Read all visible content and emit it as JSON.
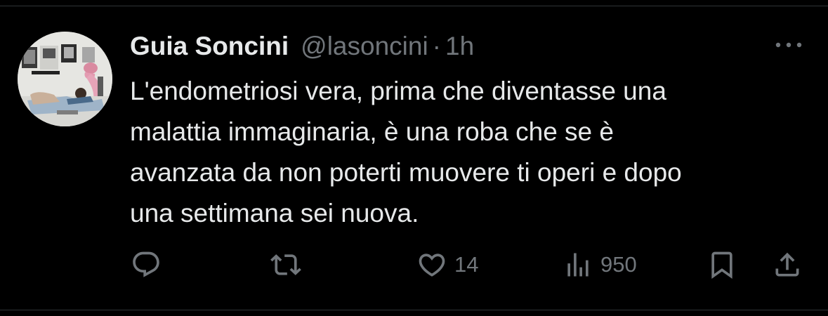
{
  "tweet": {
    "author": {
      "display_name": "Guia Soncini",
      "handle": "@lasoncini",
      "separator": "·",
      "time": "1h",
      "avatar_icon": "profile-photo"
    },
    "text": "L'endometriosi vera, prima che diventasse una\nmalattia immaginaria, è una roba che se è\navanzata da non poterti muovere ti operi e dopo\nuna settimana sei nuova.",
    "more_icon": "more-dots-icon",
    "actions": {
      "reply": {
        "icon": "reply-icon",
        "count": ""
      },
      "retweet": {
        "icon": "retweet-icon",
        "count": ""
      },
      "like": {
        "icon": "heart-icon",
        "count": "14"
      },
      "views": {
        "icon": "views-chart-icon",
        "count": "950"
      },
      "bookmark": {
        "icon": "bookmark-icon"
      },
      "share": {
        "icon": "share-icon"
      }
    }
  },
  "colors": {
    "background": "#000000",
    "primary_text": "#e7e9ea",
    "secondary_text": "#71767b",
    "divider": "#2f3336"
  }
}
